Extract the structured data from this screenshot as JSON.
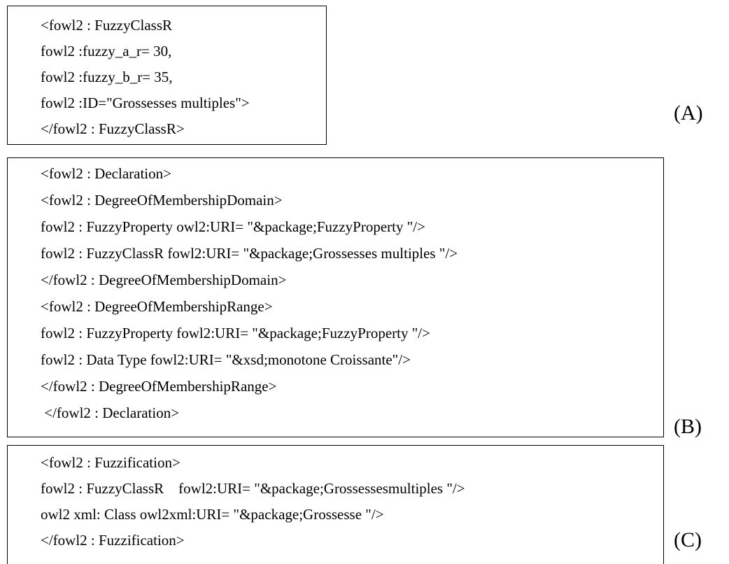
{
  "blocks": {
    "a": {
      "label": "(A)",
      "lines": [
        "<fowl2 : FuzzyClassR",
        "fowl2 :fuzzy_a_r= 30,",
        "fowl2 :fuzzy_b_r= 35,",
        "fowl2 :ID=\"Grossesses multiples\">",
        "</fowl2 : FuzzyClassR>"
      ]
    },
    "b": {
      "label": "(B)",
      "lines": [
        "<fowl2 : Declaration>",
        "<fowl2 : DegreeOfMembershipDomain>",
        "fowl2 : FuzzyProperty owl2:URI= \"&package;FuzzyProperty \"/>",
        "fowl2 : FuzzyClassR fowl2:URI= \"&package;Grossesses multiples \"/>",
        "</fowl2 : DegreeOfMembershipDomain>",
        "<fowl2 : DegreeOfMembershipRange>",
        "fowl2 : FuzzyProperty fowl2:URI= \"&package;FuzzyProperty \"/>",
        "fowl2 : Data Type fowl2:URI= \"&xsd;monotone Croissante\"/>",
        "</fowl2 : DegreeOfMembershipRange>",
        " </fowl2 : Declaration>"
      ]
    },
    "c": {
      "label": "(C)",
      "lines": [
        "<fowl2 : Fuzzification>",
        "fowl2 : FuzzyClassR    fowl2:URI= \"&package;Grossessesmultiples \"/>",
        "owl2 xml: Class owl2xml:URI= \"&package;Grossesse \"/>",
        "</fowl2 : Fuzzification>"
      ]
    }
  }
}
